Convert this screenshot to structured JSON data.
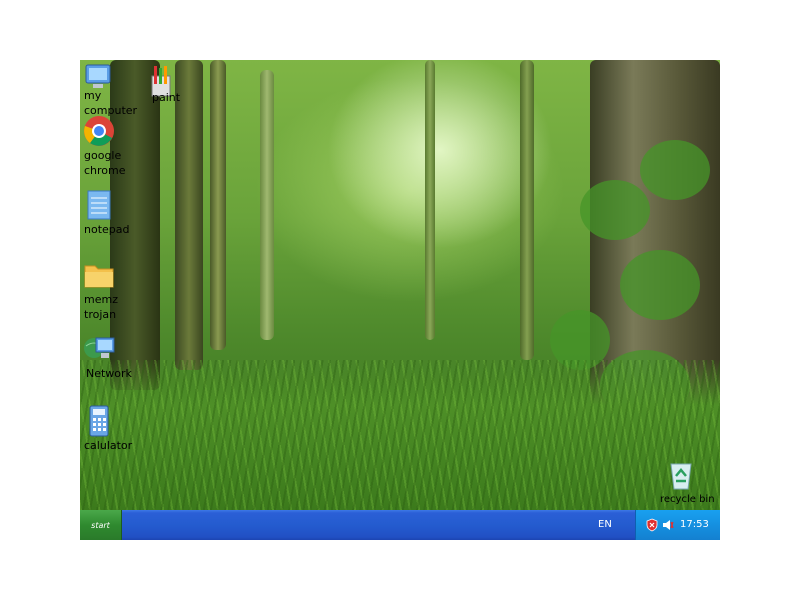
{
  "desktop": {
    "icons": [
      {
        "label": "my computer"
      },
      {
        "label": "paint"
      },
      {
        "label": "google chrome"
      },
      {
        "label": "notepad"
      },
      {
        "label": "memz trojan"
      },
      {
        "label": "Network"
      },
      {
        "label": "calulator"
      },
      {
        "label": "recycle bin"
      }
    ]
  },
  "taskbar": {
    "start_label": "start",
    "language": "EN",
    "clock": "17:53"
  },
  "colors": {
    "taskbar_blue": "#245ccf",
    "start_green": "#2f8a2f",
    "tray_blue": "#1590e0"
  },
  "icon_names": [
    "computer-icon",
    "paint-icon",
    "chrome-icon",
    "notepad-icon",
    "folder-icon",
    "network-icon",
    "calculator-icon",
    "recycle-bin-icon",
    "shield-icon",
    "speaker-icon"
  ]
}
